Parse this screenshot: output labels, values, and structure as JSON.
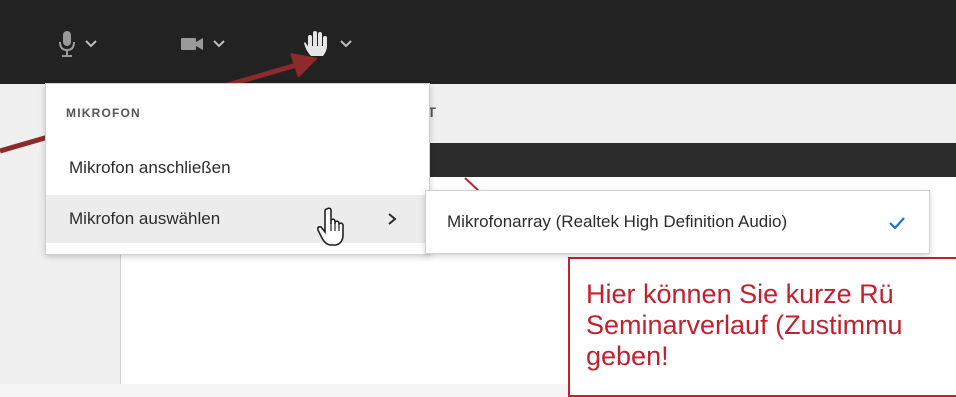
{
  "colors": {
    "topbar": "#222222",
    "accent_check": "#1473e6",
    "annotation_red": "#c3202f",
    "arrow": "#8e2a2a"
  },
  "toolbar": {
    "items": [
      {
        "icon": "microphone-icon"
      },
      {
        "icon": "camera-icon"
      },
      {
        "icon": "raise-hand-icon"
      }
    ]
  },
  "subbar": {
    "partial_label": "PT"
  },
  "menu": {
    "heading": "MIKROFON",
    "items": [
      {
        "label": "Mikrofon anschließen"
      },
      {
        "label": "Mikrofon auswählen"
      }
    ]
  },
  "submenu": {
    "items": [
      {
        "label": "Mikrofonarray (Realtek High Definition Audio)",
        "checked": true
      }
    ]
  },
  "callout": {
    "lines": [
      "Hier können Sie kurze Rü",
      "Seminarverlauf (Zustimmu",
      "geben!"
    ]
  }
}
